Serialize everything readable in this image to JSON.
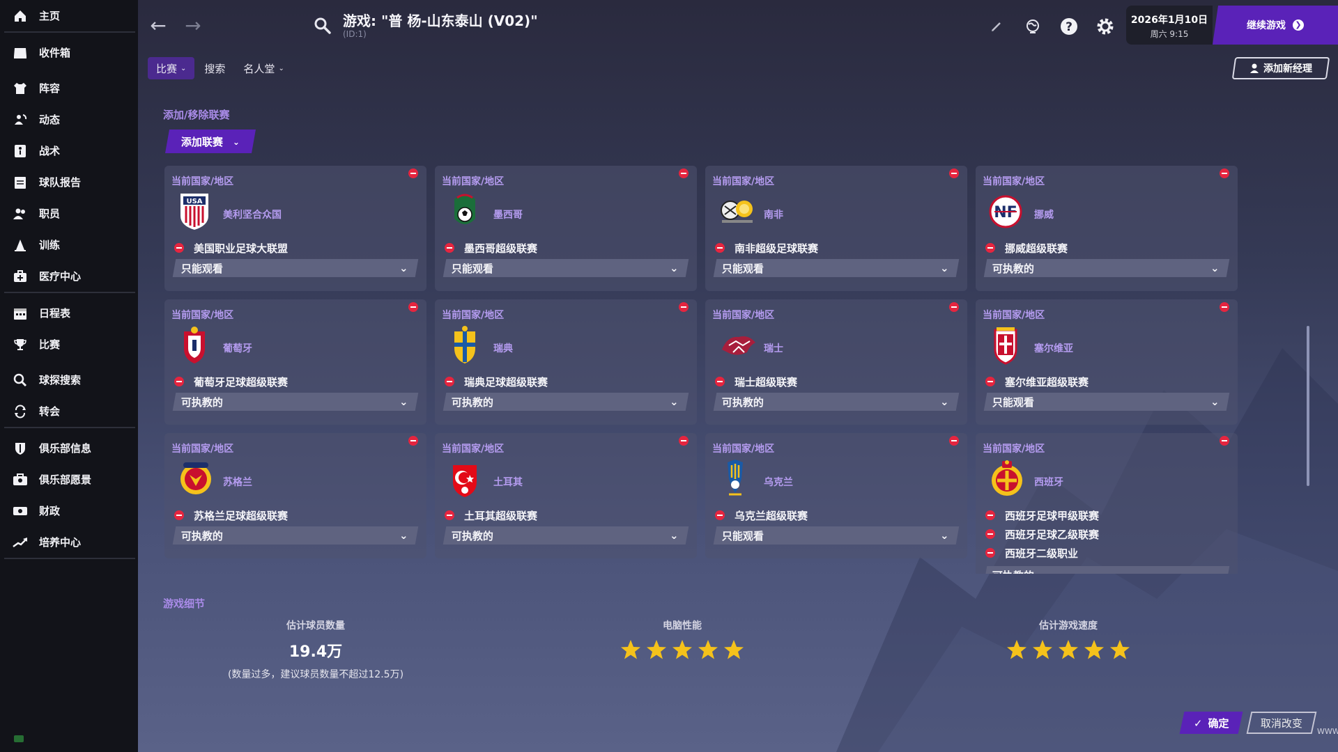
{
  "sidebar": {
    "items": [
      {
        "label": "主页",
        "icon": "home-icon"
      },
      {
        "label": "收件箱",
        "icon": "inbox-icon"
      },
      {
        "label": "阵容",
        "icon": "jersey-icon"
      },
      {
        "label": "动态",
        "icon": "dynamics-icon"
      },
      {
        "label": "战术",
        "icon": "tactics-icon"
      },
      {
        "label": "球队报告",
        "icon": "report-icon"
      },
      {
        "label": "职员",
        "icon": "staff-icon"
      },
      {
        "label": "训练",
        "icon": "training-icon"
      },
      {
        "label": "医疗中心",
        "icon": "medical-icon"
      },
      {
        "label": "日程表",
        "icon": "calendar-icon"
      },
      {
        "label": "比赛",
        "icon": "trophy-icon"
      },
      {
        "label": "球探搜索",
        "icon": "search-icon"
      },
      {
        "label": "转会",
        "icon": "transfer-icon"
      },
      {
        "label": "俱乐部信息",
        "icon": "shield-icon"
      },
      {
        "label": "俱乐部愿景",
        "icon": "vision-icon"
      },
      {
        "label": "财政",
        "icon": "finance-icon"
      },
      {
        "label": "培养中心",
        "icon": "development-icon"
      }
    ]
  },
  "header": {
    "title": "游戏: \"普 杨-山东泰山 (V02)\"",
    "subtitle": "(ID:1)",
    "date": "2026年1月10日",
    "weekday_time": "周六 9:15",
    "continue_label": "继续游戏"
  },
  "tabs": [
    {
      "label": "比赛",
      "has_dropdown": true,
      "active": true
    },
    {
      "label": "搜索",
      "has_dropdown": false,
      "active": false
    },
    {
      "label": "名人堂",
      "has_dropdown": true,
      "active": false
    }
  ],
  "add_manager_label": "添加新经理",
  "leagues_section": {
    "title": "添加/移除联赛",
    "add_button_label": "添加联赛",
    "card_label": "当前国家/地区",
    "cards": [
      {
        "country": "美利坚合众国",
        "leagues": [
          "美国职业足球大联盟"
        ],
        "mode": "只能观看"
      },
      {
        "country": "墨西哥",
        "leagues": [
          "墨西哥超级联赛"
        ],
        "mode": "只能观看"
      },
      {
        "country": "南非",
        "leagues": [
          "南非超级足球联赛"
        ],
        "mode": "只能观看"
      },
      {
        "country": "挪威",
        "leagues": [
          "挪威超级联赛"
        ],
        "mode": "可执教的"
      },
      {
        "country": "葡萄牙",
        "leagues": [
          "葡萄牙足球超级联赛"
        ],
        "mode": "可执教的"
      },
      {
        "country": "瑞典",
        "leagues": [
          "瑞典足球超级联赛"
        ],
        "mode": "可执教的"
      },
      {
        "country": "瑞士",
        "leagues": [
          "瑞士超级联赛"
        ],
        "mode": "可执教的"
      },
      {
        "country": "塞尔维亚",
        "leagues": [
          "塞尔维亚超级联赛"
        ],
        "mode": "只能观看"
      },
      {
        "country": "苏格兰",
        "leagues": [
          "苏格兰足球超级联赛"
        ],
        "mode": "可执教的"
      },
      {
        "country": "土耳其",
        "leagues": [
          "土耳其超级联赛"
        ],
        "mode": "可执教的"
      },
      {
        "country": "乌克兰",
        "leagues": [
          "乌克兰超级联赛"
        ],
        "mode": "只能观看"
      },
      {
        "country": "西班牙",
        "leagues": [
          "西班牙足球甲级联赛",
          "西班牙足球乙级联赛",
          "西班牙二级职业"
        ],
        "mode": "可执教的"
      }
    ]
  },
  "details_section": {
    "title": "游戏细节",
    "players_title": "估计球员数量",
    "players_value": "19.4万",
    "players_note": "(数量过多，建议球员数量不超过12.5万)",
    "performance_title": "电脑性能",
    "performance_stars": 5,
    "speed_title": "估计游戏速度",
    "speed_stars": 5
  },
  "footer": {
    "confirm_label": "确定",
    "cancel_label": "取消改变",
    "watermark": "WWW.PLAYSM.CC"
  },
  "colors": {
    "accent": "#5a22b8",
    "remove": "#e5253f",
    "label": "#b59cf0",
    "star": "#f5c21b"
  }
}
